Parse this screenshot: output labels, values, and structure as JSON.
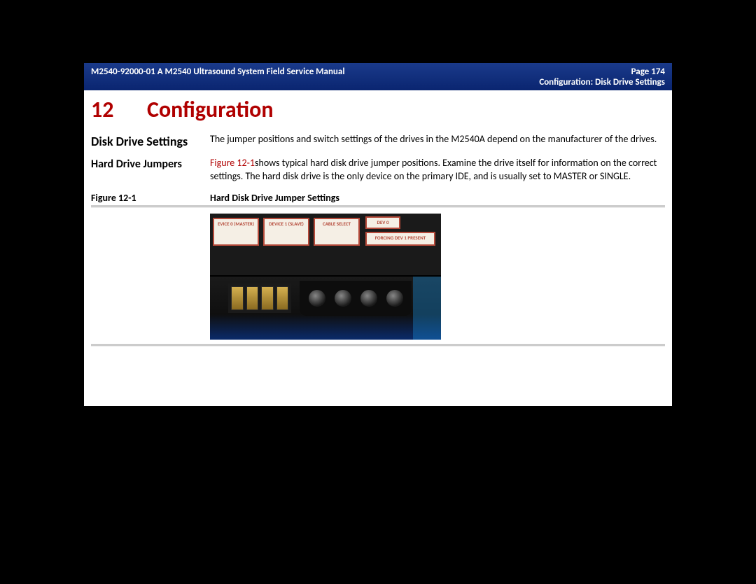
{
  "header": {
    "doc_id": "M2540-92000-01 A M2540 Ultrasound System Field Service Manual",
    "page_label": "Page 174",
    "breadcrumb": "Configuration: Disk Drive Settings"
  },
  "chapter": {
    "number": "12",
    "title": "Configuration"
  },
  "sections": {
    "disk_drive": {
      "label": "Disk Drive Settings",
      "body": "The jumper positions and switch settings of the drives in the M2540A depend on the manufacturer of the drives."
    },
    "hard_drive_jumpers": {
      "label": "Hard Drive Jumpers",
      "fig_ref": "Figure 12-1",
      "body_after": "shows typical hard disk drive jumper positions. Examine the drive itself for information on the correct settings. The hard disk drive is the only device on the primary IDE, and is usually set to MASTER or SINGLE."
    }
  },
  "figure": {
    "label": "Figure 12-1",
    "caption": "Hard Disk Drive Jumper Settings",
    "photo_labels": {
      "l1": "EVICE 0 (MASTER)",
      "l2": "DEVICE 1 (SLAVE)",
      "l3": "CABLE SELECT",
      "l4": "DEV 0",
      "l5": "FORCING DEV 1 PRESENT"
    }
  }
}
